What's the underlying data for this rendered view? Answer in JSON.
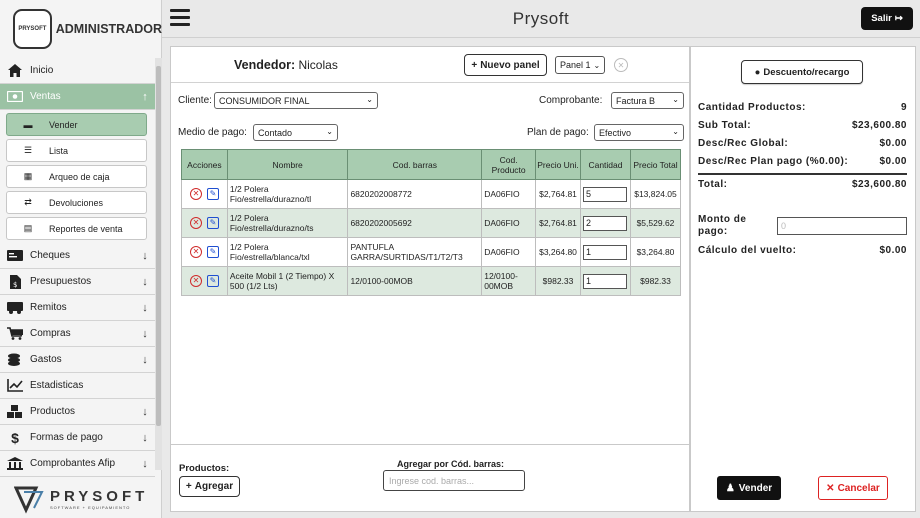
{
  "sidebar": {
    "logo_small_text": "PRYSOFT",
    "admin_label": "ADMINISTRADOR",
    "items": [
      {
        "label": "Inicio"
      },
      {
        "label": "Ventas"
      },
      {
        "label": "Cheques"
      },
      {
        "label": "Presupuestos"
      },
      {
        "label": "Remitos"
      },
      {
        "label": "Compras"
      },
      {
        "label": "Gastos"
      },
      {
        "label": "Estadisticas"
      },
      {
        "label": "Productos"
      },
      {
        "label": "Formas de pago"
      },
      {
        "label": "Comprobantes Afip"
      }
    ],
    "ventas_sub": [
      {
        "label": "Vender"
      },
      {
        "label": "Lista"
      },
      {
        "label": "Arqueo de caja"
      },
      {
        "label": "Devoluciones"
      },
      {
        "label": "Reportes de venta"
      }
    ],
    "footer_brand": "PRYSOFT",
    "footer_tagline": "SOFTWARE + EQUIPAMIENTO"
  },
  "topbar": {
    "title": "Prysoft",
    "salir_label": "Salir"
  },
  "main": {
    "vendedor_label": "Vendedor:",
    "vendedor_name": "Nicolas",
    "nuevo_panel_label": "Nuevo panel",
    "panel_select": "Panel 1",
    "cliente_label": "Cliente:",
    "cliente_value": "CONSUMIDOR FINAL",
    "comprobante_label": "Comprobante:",
    "comprobante_value": "Factura B",
    "medio_pago_label": "Medio de pago:",
    "medio_pago_value": "Contado",
    "plan_pago_label": "Plan de pago:",
    "plan_pago_value": "Efectivo",
    "table": {
      "headers": [
        "Acciones",
        "Nombre",
        "Cod. barras",
        "Cod. Producto",
        "Precio Uni.",
        "Cantidad",
        "Precio Total"
      ],
      "rows": [
        {
          "nombre": "1/2 Polera Fio/estrella/durazno/tl",
          "cod_barras": "6820202008772",
          "cod_producto": "DA06FIO",
          "precio_uni": "$2,764.81",
          "cantidad": "5",
          "precio_total": "$13,824.05"
        },
        {
          "nombre": "1/2 Polera Fio/estrella/durazno/ts",
          "cod_barras": "6820202005692",
          "cod_producto": "DA06FIO",
          "precio_uni": "$2,764.81",
          "cantidad": "2",
          "precio_total": "$5,529.62"
        },
        {
          "nombre": "1/2 Polera Fio/estrella/blanca/txl",
          "cod_barras": "PANTUFLA GARRA/SURTIDAS/T1/T2/T3",
          "cod_producto": "DA06FIO",
          "precio_uni": "$3,264.80",
          "cantidad": "1",
          "precio_total": "$3,264.80"
        },
        {
          "nombre": "Aceite Mobil 1 (2 Tiempo) X 500 (1/2 Lts)",
          "cod_barras": "12/0100-00MOB",
          "cod_producto": "12/0100-00MOB",
          "precio_uni": "$982.33",
          "cantidad": "1",
          "precio_total": "$982.33"
        }
      ]
    },
    "productos_label": "Productos:",
    "agregar_label": "Agregar",
    "agregar_cb_label": "Agregar por Cód. barras:",
    "cb_placeholder": "Ingrese cod. barras..."
  },
  "summary": {
    "descuento_btn": "Descuento/recargo",
    "rows": [
      {
        "label": "Cantidad Productos:",
        "value": "9"
      },
      {
        "label": "Sub Total:",
        "value": "$23,600.80"
      },
      {
        "label": "Desc/Rec Global:",
        "value": "$0.00"
      },
      {
        "label": "Desc/Rec Plan pago (%0.00):",
        "value": "$0.00"
      }
    ],
    "total_label": "Total:",
    "total_value": "$23,600.80",
    "monto_label": "Monto de pago:",
    "monto_placeholder": "0",
    "vuelto_label": "Cálculo del vuelto:",
    "vuelto_value": "$0.00",
    "vender_label": "Vender",
    "cancelar_label": "Cancelar"
  }
}
